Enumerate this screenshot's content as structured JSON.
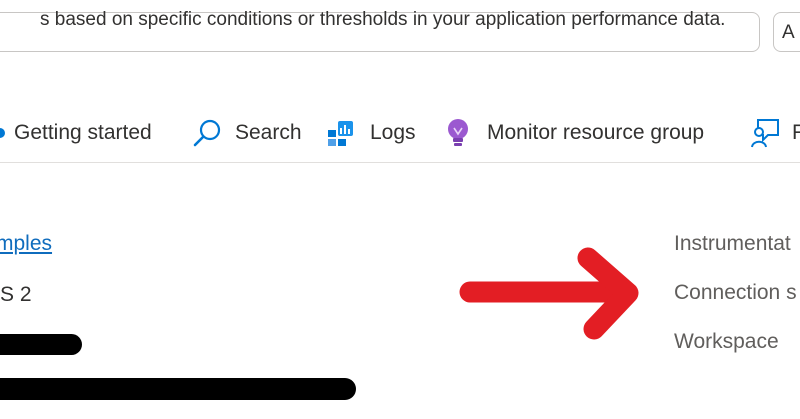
{
  "banner": {
    "text": "s based on specific conditions or thresholds in your application performance data.",
    "button_label": "A"
  },
  "toolbar": {
    "items": [
      {
        "label": "Getting started",
        "icon": "getting-started-icon"
      },
      {
        "label": "Search",
        "icon": "search-icon"
      },
      {
        "label": "Logs",
        "icon": "logs-icon"
      },
      {
        "label": "Monitor resource group",
        "icon": "lightbulb-icon"
      },
      {
        "label": "F",
        "icon": "feedback-icon"
      }
    ]
  },
  "essentials": {
    "samples_link": "mples",
    "version": "S 2",
    "properties": [
      "Instrumentat",
      "Connection s",
      "Workspace"
    ]
  },
  "annotations": {
    "arrow_color": "#e31e24",
    "redaction_color": "#000000"
  }
}
